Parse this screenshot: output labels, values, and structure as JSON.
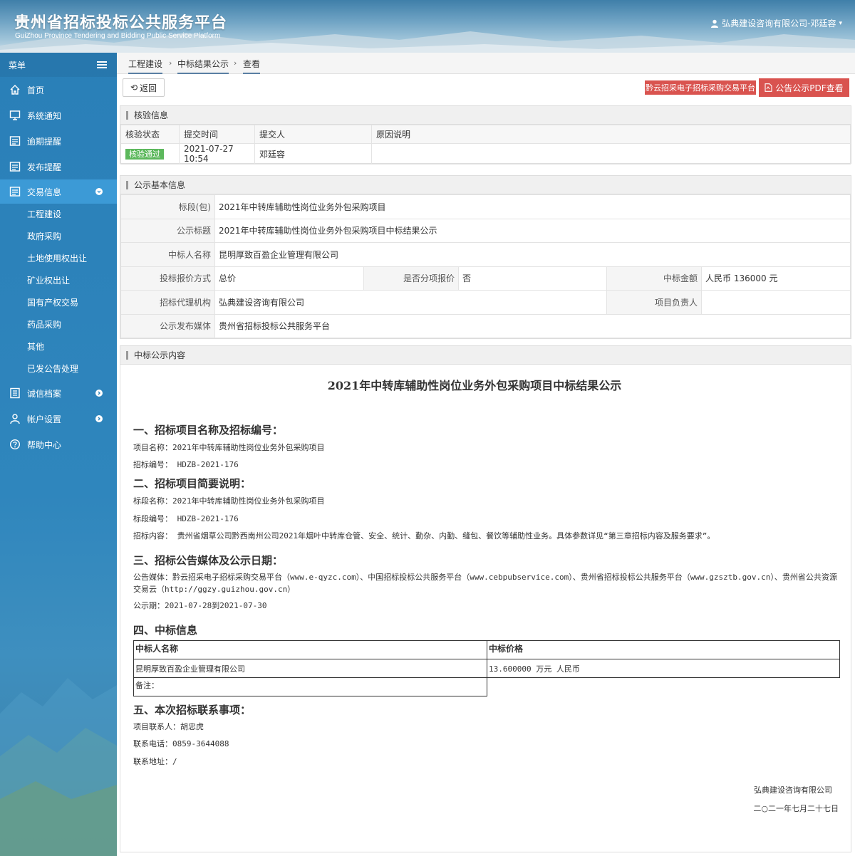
{
  "header": {
    "title_cn": "贵州省招标投标公共服务平台",
    "title_en": "GuiZhou Province Tendering and Bidding Public Service Platform",
    "user_label": "弘典建设咨询有限公司-邓廷容"
  },
  "sidebar": {
    "menu_label": "菜单",
    "items": [
      {
        "label": "首页",
        "icon": "home-icon"
      },
      {
        "label": "系统通知",
        "icon": "monitor-icon"
      },
      {
        "label": "逾期提醒",
        "icon": "list-icon"
      },
      {
        "label": "发布提醒",
        "icon": "list-icon"
      },
      {
        "label": "交易信息",
        "icon": "list-icon"
      }
    ],
    "sub_items": [
      "工程建设",
      "政府采购",
      "土地使用权出让",
      "矿业权出让",
      "国有产权交易",
      "药品采购",
      "其他",
      "已发公告处理"
    ],
    "bottom_items": [
      {
        "label": "诚信档案",
        "icon": "file-icon"
      },
      {
        "label": "帐户设置",
        "icon": "user-icon"
      },
      {
        "label": "帮助中心",
        "icon": "help-icon"
      }
    ]
  },
  "breadcrumb": [
    "工程建设",
    "中标结果公示",
    "查看"
  ],
  "toolbar": {
    "back_label": "返回",
    "qianyun_label": "黔云招采电子招标采购交易平台",
    "pdf_label": "公告公示PDF查看"
  },
  "verify": {
    "title": "核验信息",
    "headers": [
      "核验状态",
      "提交时间",
      "提交人",
      "原因说明"
    ],
    "status": "核验通过",
    "time": "2021-07-27 10:54",
    "person": "邓廷容",
    "reason": ""
  },
  "basic": {
    "title": "公示基本信息",
    "section_label": "标段(包)",
    "section_value": "2021年中转库辅助性岗位业务外包采购项目",
    "notice_title_label": "公示标题",
    "notice_title_value": "2021年中转库辅助性岗位业务外包采购项目中标结果公示",
    "winner_label": "中标人名称",
    "winner_value": "昆明厚致百盈企业管理有限公司",
    "quote_mode_label": "投标报价方式",
    "quote_mode_value": "总价",
    "sub_quote_label": "是否分项报价",
    "sub_quote_value": "否",
    "amount_label": "中标金额",
    "amount_value": "人民币 136000 元",
    "agency_label": "招标代理机构",
    "agency_value": "弘典建设咨询有限公司",
    "manager_label": "项目负责人",
    "manager_value": "",
    "media_label": "公示发布媒体",
    "media_value": "贵州省招标投标公共服务平台"
  },
  "content": {
    "panel_title": "中标公示内容",
    "title": "2021年中转库辅助性岗位业务外包采购项目中标结果公示",
    "s1_head": "一、招标项目名称及招标编号：",
    "s1_line1": "项目名称：2021年中转库辅助性岗位业务外包采购项目",
    "s1_line2": "招标编号：  HDZB-2021-176",
    "s2_head": "二、招标项目简要说明：",
    "s2_line1": "标段名称：2021年中转库辅助性岗位业务外包采购项目",
    "s2_line2": "标段编号：  HDZB-2021-176",
    "s2_line3": "招标内容：  贵州省烟草公司黔西南州公司2021年烟叶中转库仓管、安全、统计、勤杂、内勤、缝包、餐饮等辅助性业务。具体参数详见“第三章招标内容及服务要求”。",
    "s3_head": "三、招标公告媒体及公示日期：",
    "s3_line1": "公告媒体：黔云招采电子招标采购交易平台（www.e-qyzc.com）、中国招标投标公共服务平台（www.cebpubservice.com）、贵州省招标投标公共服务平台（www.gzsztb.gov.cn）、贵州省公共资源交易云（http://ggzy.guizhou.gov.cn）",
    "s3_line2": "公示期：2021-07-28到2021-07-30",
    "s4_head": "四、中标信息",
    "win_h1": "中标人名称",
    "win_h2": "中标价格",
    "win_name": "昆明厚致百盈企业管理有限公司",
    "win_price": "13.600000 万元 人民币",
    "win_note": "备注：",
    "s5_head": "五、本次招标联系事项：",
    "s5_line1": "项目联系人：胡忠虎",
    "s5_line2": "联系电话：0859-3644088",
    "s5_line3": "联系地址：/",
    "sign_org": "弘典建设咨询有限公司",
    "sign_date": "二○二一年七月二十七日"
  },
  "colors": {
    "header_blue": "#3f7fa9",
    "sidebar_blue": "#2a7fb8",
    "active_item": "#3c9ad6",
    "danger": "#d9534f",
    "success": "#5cb85c"
  }
}
